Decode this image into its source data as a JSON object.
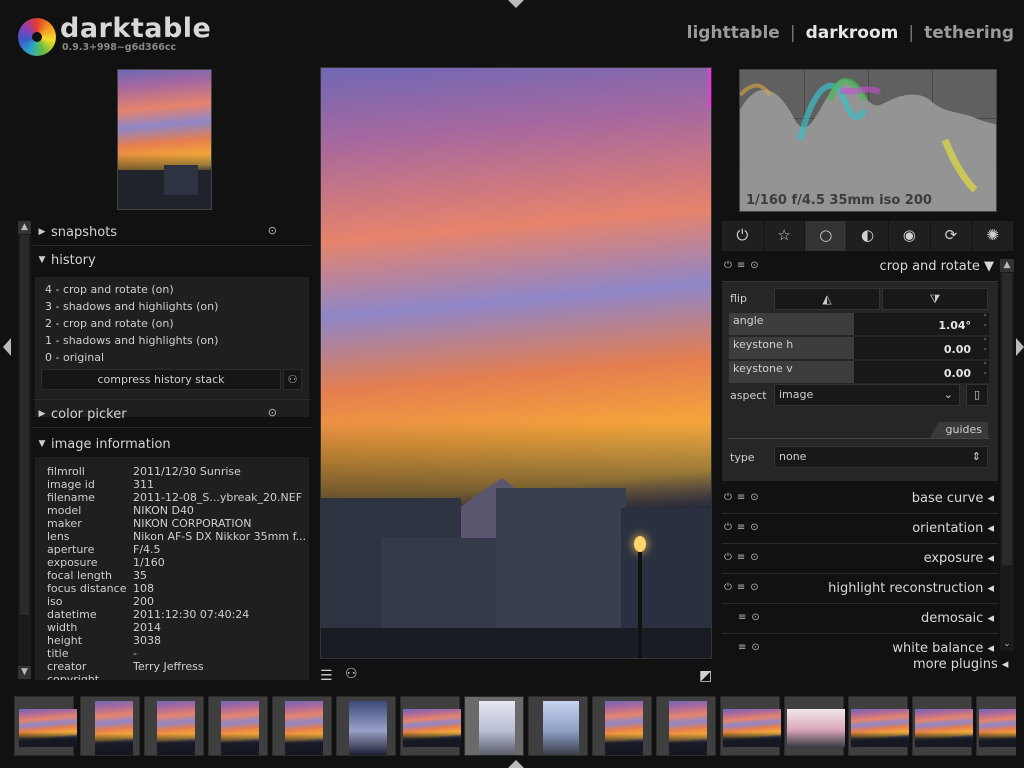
{
  "app": {
    "name": "darktable",
    "version": "0.9.3+998~g6d366cc"
  },
  "views": [
    "lighttable",
    "darkroom",
    "tethering"
  ],
  "views_sep": "|",
  "left": {
    "snapshots_label": "snapshots",
    "history_label": "history",
    "history_items": [
      "4 - crop and rotate (on)",
      "3 - shadows and highlights (on)",
      "2 - crop and rotate (on)",
      "1 - shadows and highlights (on)",
      "0 - original"
    ],
    "compress_label": "compress history stack",
    "color_picker_label": "color picker",
    "image_info_label": "image information",
    "image_info": [
      {
        "k": "filmroll",
        "v": "2011/12/30 Sunrise"
      },
      {
        "k": "image id",
        "v": "311"
      },
      {
        "k": "filename",
        "v": "2011-12-08_S...ybreak_20.NEF"
      },
      {
        "k": "model",
        "v": "NIKON D40"
      },
      {
        "k": "maker",
        "v": "NIKON CORPORATION"
      },
      {
        "k": "lens",
        "v": "Nikon AF-S DX Nikkor 35mm f..."
      },
      {
        "k": "aperture",
        "v": "F/4.5"
      },
      {
        "k": "exposure",
        "v": "1/160"
      },
      {
        "k": "focal length",
        "v": "35"
      },
      {
        "k": "focus distance",
        "v": "108"
      },
      {
        "k": "iso",
        "v": "200"
      },
      {
        "k": "datetime",
        "v": "2011:12:30 07:40:24"
      },
      {
        "k": "width",
        "v": "2014"
      },
      {
        "k": "height",
        "v": "3038"
      },
      {
        "k": "title",
        "v": "-"
      },
      {
        "k": "creator",
        "v": "Terry Jeffress"
      },
      {
        "k": "copyright",
        "v": ""
      }
    ]
  },
  "histogram": {
    "exif": "1/160 f/4.5 35mm iso 200"
  },
  "modules": {
    "crop": {
      "name": "crop and rotate",
      "flip_label": "flip",
      "angle": {
        "name": "angle",
        "value": "1.04°"
      },
      "keystone_h": {
        "name": "keystone h",
        "value": "0.00"
      },
      "keystone_v": {
        "name": "keystone v",
        "value": "0.00"
      },
      "aspect_label": "aspect",
      "aspect_value": "image",
      "guides_label": "guides",
      "type_label": "type",
      "type_value": "none"
    },
    "list": [
      "base curve",
      "orientation",
      "exposure",
      "highlight reconstruction",
      "demosaic",
      "white balance"
    ],
    "more_plugins": "more plugins"
  }
}
